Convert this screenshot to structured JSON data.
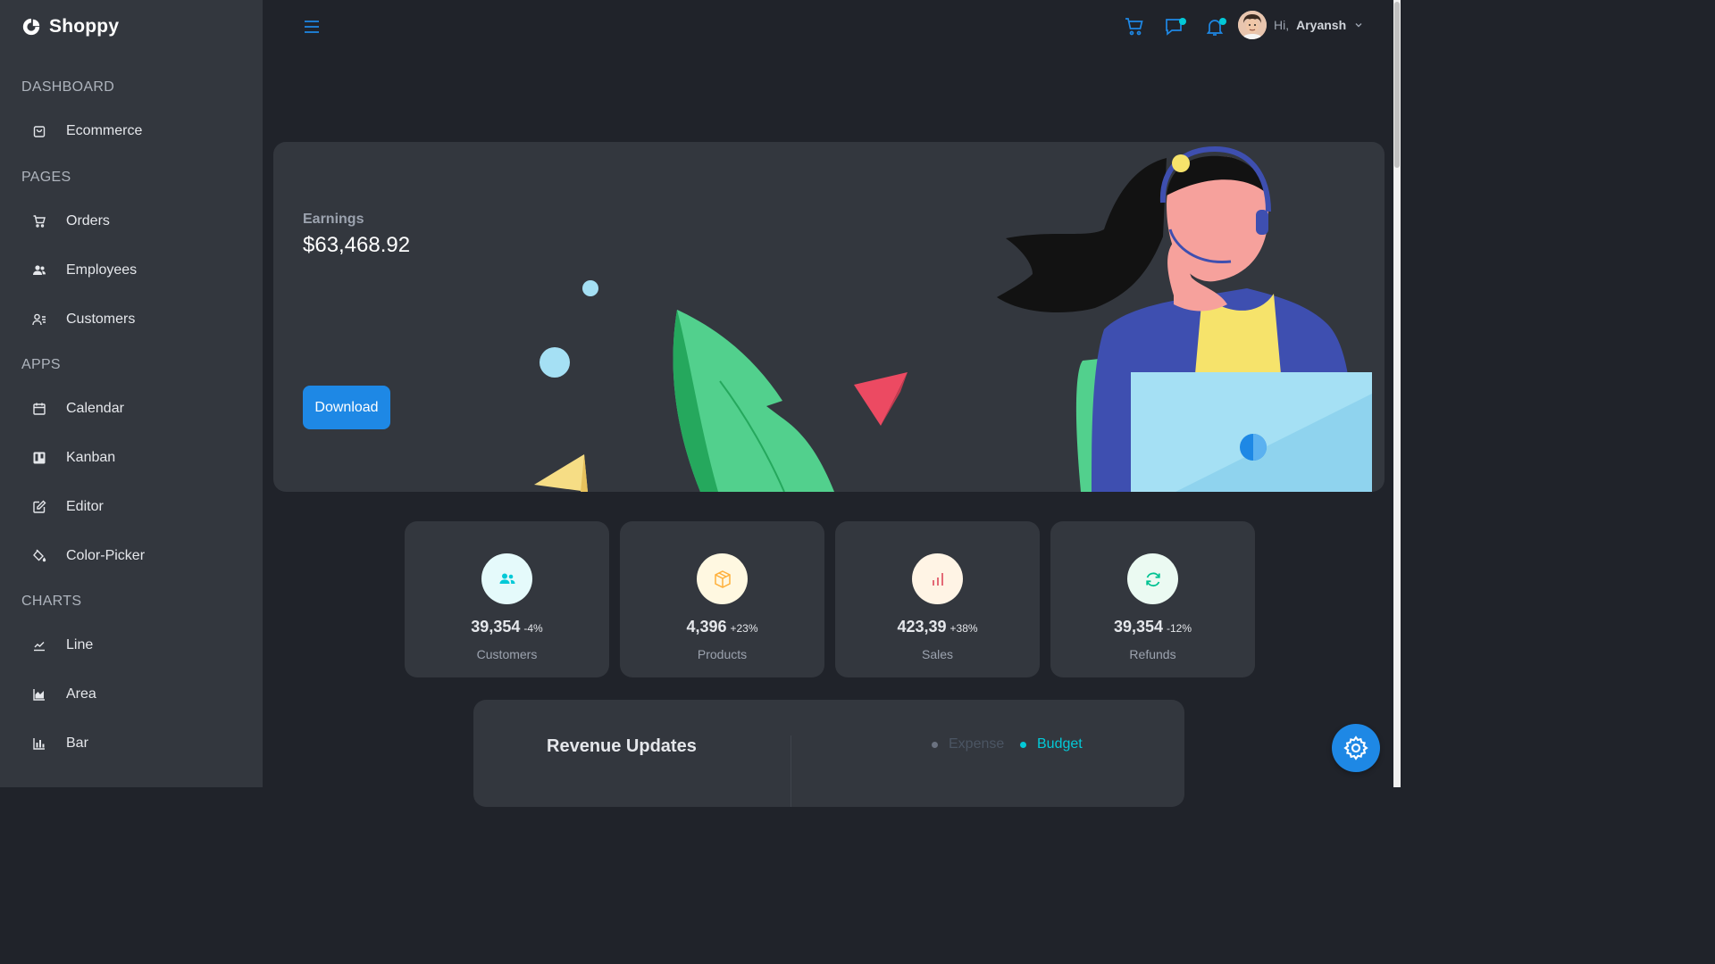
{
  "app": {
    "brand": "Shoppy"
  },
  "sidebar": {
    "sections": [
      {
        "title": "DASHBOARD",
        "items": [
          {
            "label": "Ecommerce",
            "icon": "shopping-bag-icon"
          }
        ]
      },
      {
        "title": "PAGES",
        "items": [
          {
            "label": "Orders",
            "icon": "cart-icon"
          },
          {
            "label": "Employees",
            "icon": "people-icon"
          },
          {
            "label": "Customers",
            "icon": "user-list-icon"
          }
        ]
      },
      {
        "title": "APPS",
        "items": [
          {
            "label": "Calendar",
            "icon": "calendar-icon"
          },
          {
            "label": "Kanban",
            "icon": "kanban-icon"
          },
          {
            "label": "Editor",
            "icon": "edit-icon"
          },
          {
            "label": "Color-Picker",
            "icon": "paint-bucket-icon"
          }
        ]
      },
      {
        "title": "CHARTS",
        "items": [
          {
            "label": "Line",
            "icon": "line-chart-icon"
          },
          {
            "label": "Area",
            "icon": "area-chart-icon"
          },
          {
            "label": "Bar",
            "icon": "bar-chart-icon"
          }
        ]
      }
    ]
  },
  "topbar": {
    "greeting": "Hi,",
    "username": "Aryansh",
    "accent": "#03c9d7"
  },
  "earnings": {
    "label": "Earnings",
    "value": "$63,468.92",
    "download_label": "Download"
  },
  "stats": [
    {
      "value": "39,354",
      "pct": "-4%",
      "name": "Customers",
      "icon": "people-icon",
      "icon_color": "#03c9d7",
      "icon_bg": "#e5fafb"
    },
    {
      "value": "4,396",
      "pct": "+23%",
      "name": "Products",
      "icon": "box-icon",
      "icon_color": "#ffb03b",
      "icon_bg": "#fff8e1"
    },
    {
      "value": "423,39",
      "pct": "+38%",
      "name": "Sales",
      "icon": "bar-chart-icon",
      "icon_color": "#e46a76",
      "icon_bg": "#fff4e5"
    },
    {
      "value": "39,354",
      "pct": "-12%",
      "name": "Refunds",
      "icon": "refresh-icon",
      "icon_color": "#00c292",
      "icon_bg": "#ebfaf2"
    }
  ],
  "revenue": {
    "title": "Revenue Updates",
    "legend": [
      {
        "label": "Expense",
        "color": "#4b5563"
      },
      {
        "label": "Budget",
        "color": "#03c9d7"
      }
    ]
  }
}
